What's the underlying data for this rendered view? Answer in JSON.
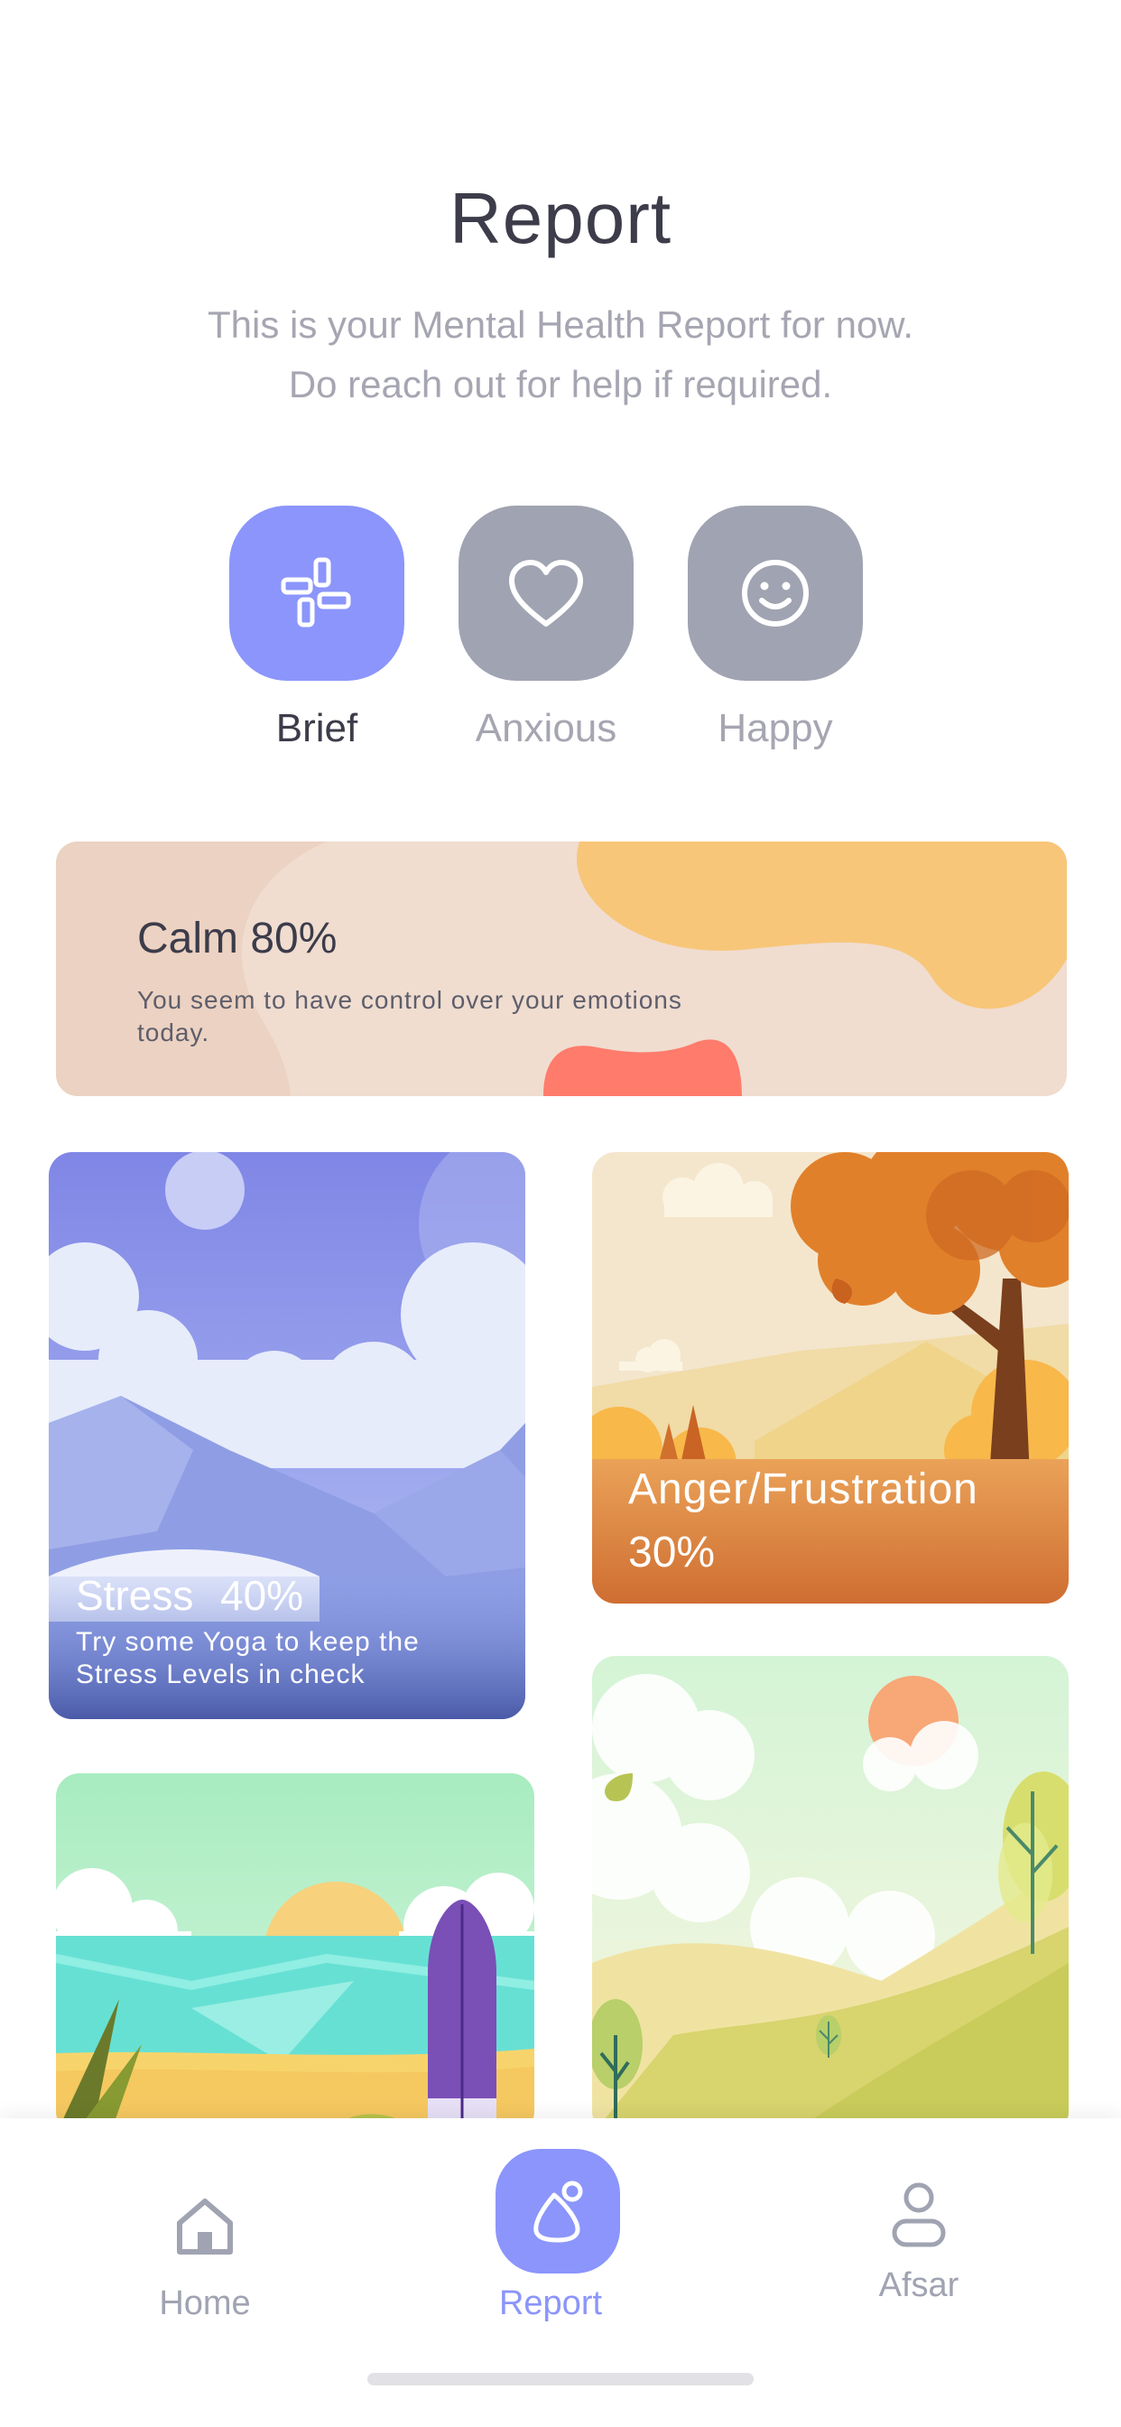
{
  "header": {
    "title": "Report",
    "subtitle_line1": "This is your Mental Health Report for now.",
    "subtitle_line2": "Do reach out for help if required."
  },
  "moods": [
    {
      "label": "Brief",
      "icon": "grid-blocks-icon",
      "active": true
    },
    {
      "label": "Anxious",
      "icon": "heart-icon",
      "active": false
    },
    {
      "label": "Happy",
      "icon": "smiley-icon",
      "active": false
    }
  ],
  "calm_card": {
    "title": "Calm 80%",
    "description_line1": "You seem to have control over your emotions",
    "description_line2": "today."
  },
  "stress_card": {
    "title": "Stress",
    "percent": "40%",
    "description_line1": "Try some Yoga to keep the",
    "description_line2": "Stress Levels in check"
  },
  "anger_card": {
    "title": "Anger/Frustration",
    "percent": "30%"
  },
  "nav": {
    "home": "Home",
    "report": "Report",
    "profile": "Afsar"
  },
  "colors": {
    "accent": "#8b95fb",
    "inactive": "#a0a3b1",
    "title": "#3c3c4a",
    "muted": "#a6a6b2"
  }
}
